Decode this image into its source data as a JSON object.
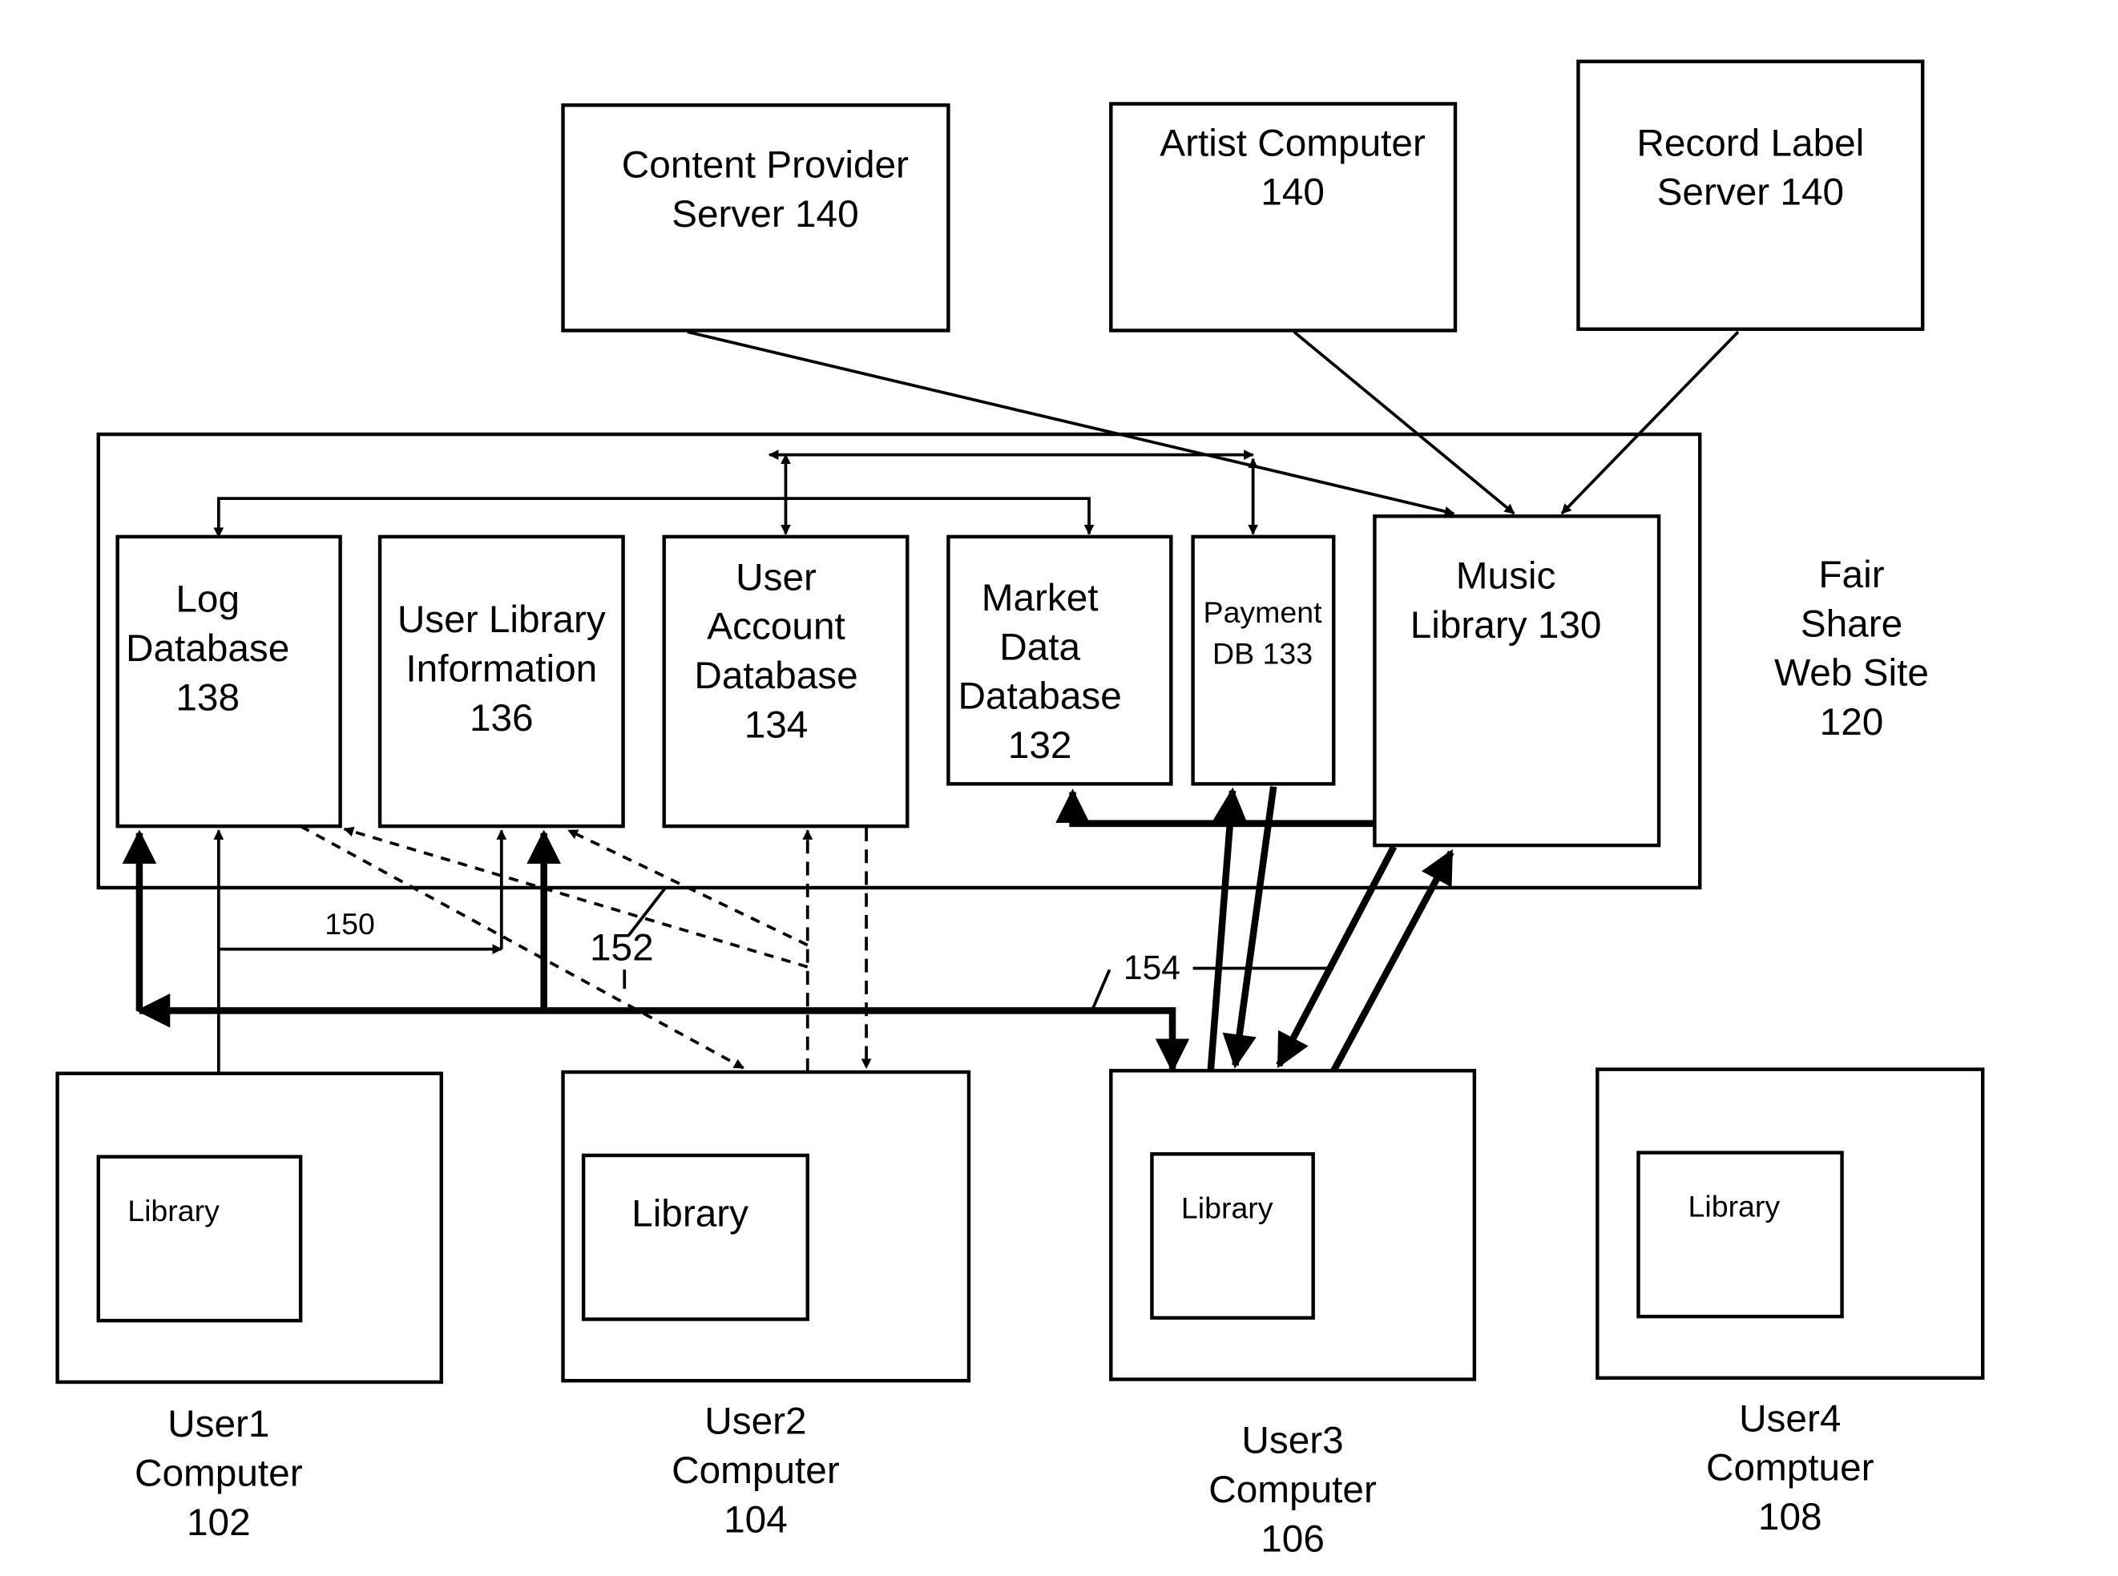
{
  "diagram": {
    "external_sources": [
      {
        "id": "content-provider",
        "lines": [
          "Content Provider",
          "Server 140"
        ]
      },
      {
        "id": "artist-computer",
        "lines": [
          "Artist Computer",
          "140"
        ]
      },
      {
        "id": "record-label",
        "lines": [
          "Record Label",
          "Server 140"
        ]
      }
    ],
    "web_site": {
      "lines": [
        "Fair",
        "Share",
        "Web Site",
        "120"
      ]
    },
    "databases": [
      {
        "id": "log-database",
        "lines": [
          "Log",
          "Database",
          "138"
        ]
      },
      {
        "id": "user-library-information",
        "lines": [
          "User Library",
          "Information",
          "136"
        ]
      },
      {
        "id": "user-account-database",
        "lines": [
          "User",
          "Account",
          "Database",
          "134"
        ]
      },
      {
        "id": "market-data-database",
        "lines": [
          "Market",
          "Data",
          "Database",
          "132"
        ]
      },
      {
        "id": "payment-db",
        "lines": [
          "Payment",
          "DB 133"
        ]
      },
      {
        "id": "music-library",
        "lines": [
          "Music",
          "Library 130"
        ]
      }
    ],
    "users": [
      {
        "id": "user1",
        "library": "Library",
        "lines": [
          "User1",
          "Computer",
          "102"
        ]
      },
      {
        "id": "user2",
        "library": "Library",
        "lines": [
          "User2",
          "Computer",
          "104"
        ]
      },
      {
        "id": "user3",
        "library": "Library",
        "lines": [
          "User3",
          "Computer",
          "106"
        ]
      },
      {
        "id": "user4",
        "library": "Library",
        "lines": [
          "User4",
          "Comptuer",
          "108"
        ]
      }
    ],
    "reference_labels": {
      "path_150": "150",
      "path_152": "152",
      "path_154": "154"
    }
  }
}
